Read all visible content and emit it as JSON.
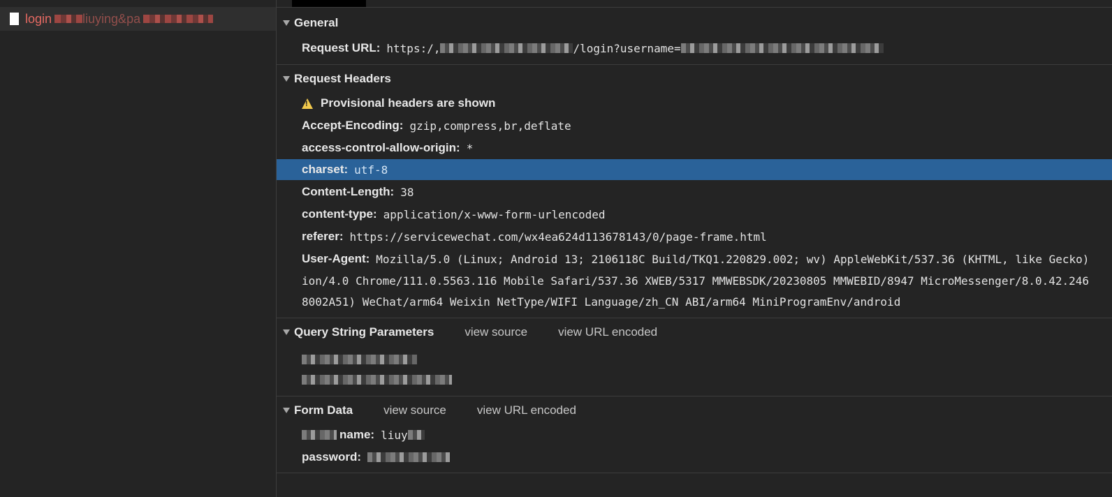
{
  "request_list": {
    "item": {
      "name": "login",
      "visible_fragment": "liuying&pa"
    }
  },
  "general": {
    "title": "General",
    "request_url_label": "Request URL:",
    "request_url_start": "https:/,",
    "request_url_middle": "/login?username="
  },
  "request_headers": {
    "title": "Request Headers",
    "warning": "Provisional headers are shown",
    "headers": [
      {
        "key": "Accept-Encoding:",
        "value": "gzip,compress,br,deflate"
      },
      {
        "key": "access-control-allow-origin:",
        "value": "*"
      },
      {
        "key": "charset:",
        "value": "utf-8"
      },
      {
        "key": "Content-Length:",
        "value": "38"
      },
      {
        "key": "content-type:",
        "value": "application/x-www-form-urlencoded"
      },
      {
        "key": "referer:",
        "value": "https://servicewechat.com/wx4ea624d113678143/0/page-frame.html"
      }
    ],
    "user_agent": {
      "key": "User-Agent:",
      "line1": "Mozilla/5.0 (Linux; Android 13; 2106118C Build/TKQ1.220829.002; wv) AppleWebKit/537.36 (KHTML, like Gecko)",
      "line2": "ion/4.0 Chrome/111.0.5563.116 Mobile Safari/537.36 XWEB/5317 MMWEBSDK/20230805 MMWEBID/8947 MicroMessenger/8.0.42.246",
      "line3": "8002A51) WeChat/arm64 Weixin NetType/WIFI Language/zh_CN ABI/arm64 MiniProgramEnv/android"
    }
  },
  "query_string": {
    "title": "Query String Parameters",
    "view_source": "view source",
    "view_url_encoded": "view URL encoded"
  },
  "form_data": {
    "title": "Form Data",
    "view_source": "view source",
    "view_url_encoded": "view URL encoded",
    "fields": [
      {
        "key": "name:",
        "value": "liuy"
      },
      {
        "key": "password:",
        "value": ""
      }
    ]
  }
}
